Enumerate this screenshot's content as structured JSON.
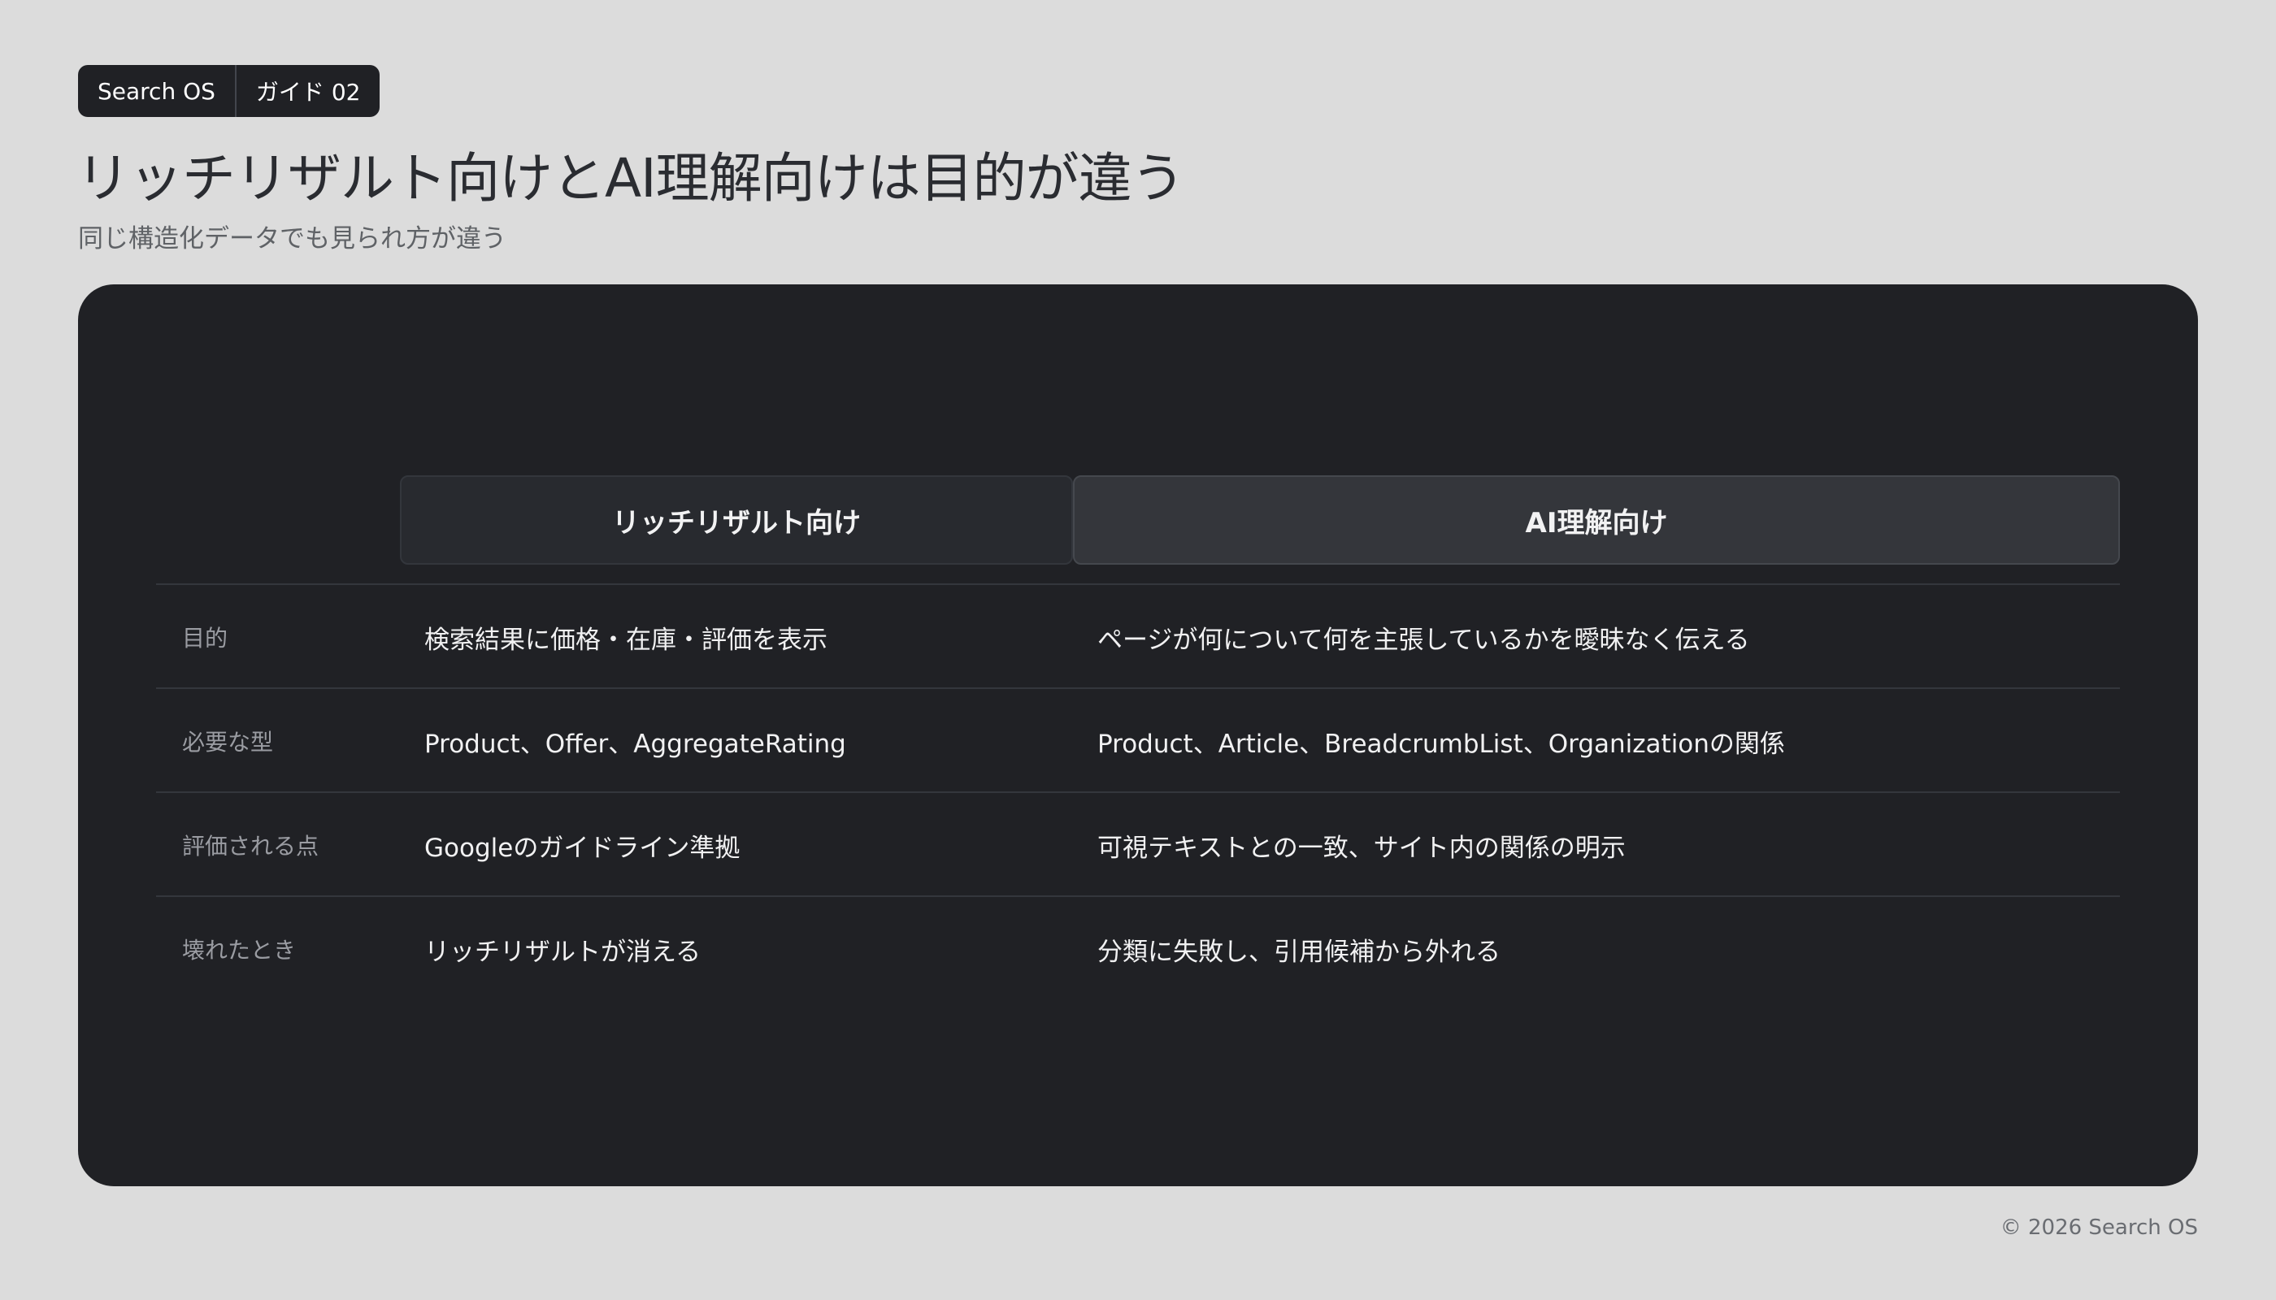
{
  "header": {
    "badge": [
      "Search OS",
      "ガイド 02"
    ],
    "title": "リッチリザルト向けとAI理解向けは目的が違う",
    "subtitle": "同じ構造化データでも見られ方が違う"
  },
  "table": {
    "columns": [
      "リッチリザルト向け",
      "AI理解向け"
    ],
    "rows": [
      {
        "label": "目的",
        "a": "検索結果に価格・在庫・評価を表示",
        "b": "ページが何について何を主張しているかを曖昧なく伝える"
      },
      {
        "label": "必要な型",
        "a": "Product、Offer、AggregateRating",
        "b": "Product、Article、BreadcrumbList、Organizationの関係"
      },
      {
        "label": "評価される点",
        "a": "Googleのガイドライン準拠",
        "b": "可視テキストとの一致、サイト内の関係の明示"
      },
      {
        "label": "壊れたとき",
        "a": "リッチリザルトが消える",
        "b": "分類に失敗し、引用候補から外れる"
      }
    ]
  },
  "footer": {
    "copyright": "© 2026 Search OS"
  }
}
